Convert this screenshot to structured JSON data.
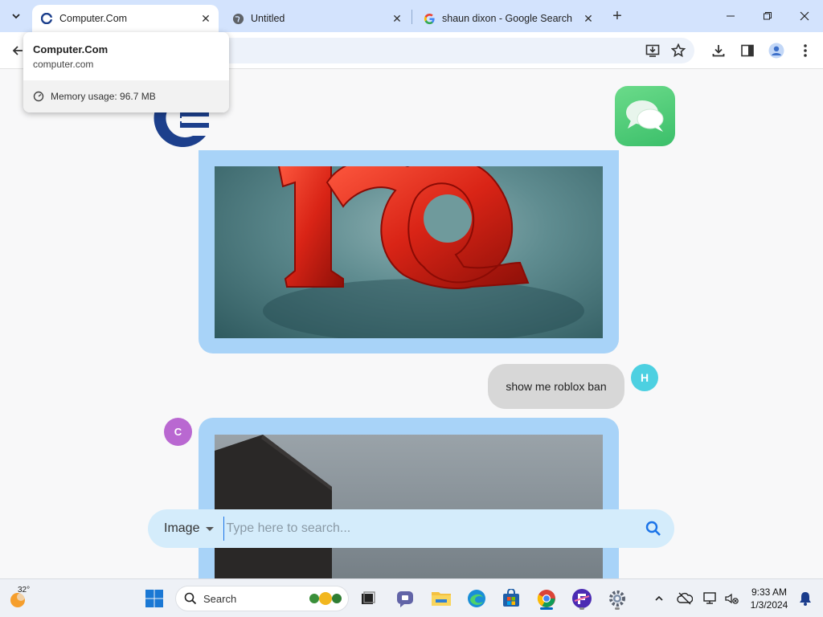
{
  "browser": {
    "tabs": [
      {
        "title": "Computer.Com",
        "active": true,
        "favicon": "computer-com-icon"
      },
      {
        "title": "Untitled",
        "active": false,
        "favicon": "globe-icon"
      },
      {
        "title": "shaun dixon - Google Search",
        "active": false,
        "favicon": "google-icon"
      }
    ],
    "hover_card": {
      "title": "Computer.Com",
      "domain": "computer.com",
      "memory": "Memory usage: 96.7 MB"
    }
  },
  "chat": {
    "user_message": "show me roblox ban",
    "user_avatar": "H",
    "assistant_avatar": "C"
  },
  "search": {
    "mode": "Image",
    "placeholder": "Type here to search..."
  },
  "taskbar": {
    "weather_temp": "32°",
    "search_label": "Search",
    "time": "9:33 AM",
    "date": "1/3/2024"
  },
  "colors": {
    "tabstrip": "#d3e3fd",
    "bubble": "#a8d3f8",
    "searchbar": "#d4ecfb",
    "user_avatar": "#4dd0e1",
    "assistant_avatar": "#b968d1"
  }
}
